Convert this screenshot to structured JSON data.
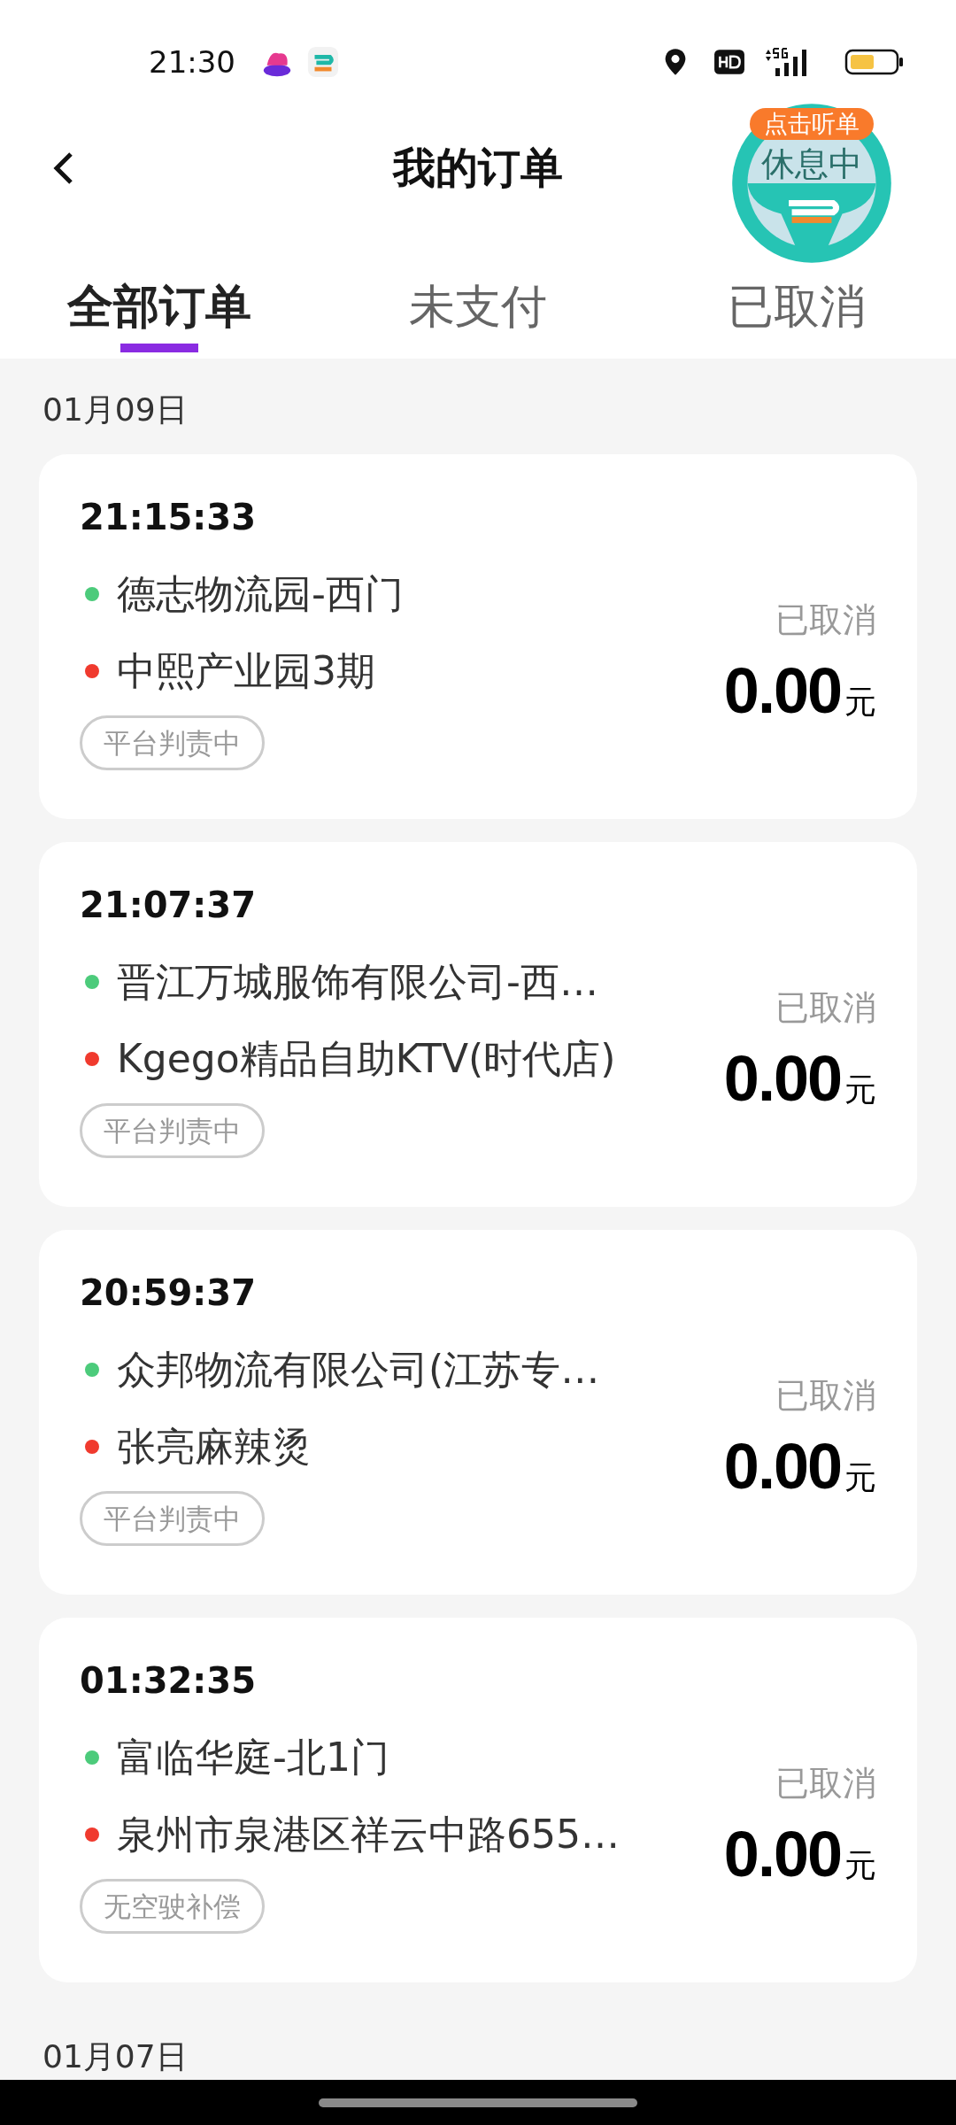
{
  "status_bar": {
    "time": "21:30"
  },
  "header": {
    "title": "我的订单"
  },
  "floating_badge": {
    "tag": "点击听单",
    "status": "休息中"
  },
  "tabs": [
    {
      "label": "全部订单",
      "selected": true
    },
    {
      "label": "未支付",
      "selected": false
    },
    {
      "label": "已取消",
      "selected": false
    }
  ],
  "groups": [
    {
      "date": "01月09日",
      "orders": [
        {
          "time": "21:15:33",
          "stops": [
            {
              "name": "德志物流园-西门",
              "color": "#4ccb7b"
            },
            {
              "name": "中熙产业园3期",
              "color": "#f03a2e"
            }
          ],
          "tag": "平台判责中",
          "status": "已取消",
          "amount": "0.00",
          "unit": "元"
        },
        {
          "time": "21:07:37",
          "stops": [
            {
              "name": "晋江万城服饰有限公司-西…",
              "color": "#4ccb7b"
            },
            {
              "name": "Kgego精品自助KTV(时代店)",
              "color": "#f03a2e"
            }
          ],
          "tag": "平台判责中",
          "status": "已取消",
          "amount": "0.00",
          "unit": "元"
        },
        {
          "time": "20:59:37",
          "stops": [
            {
              "name": "众邦物流有限公司(江苏专…",
              "color": "#4ccb7b"
            },
            {
              "name": "张亮麻辣烫",
              "color": "#f03a2e"
            }
          ],
          "tag": "平台判责中",
          "status": "已取消",
          "amount": "0.00",
          "unit": "元"
        },
        {
          "time": "01:32:35",
          "stops": [
            {
              "name": "富临华庭-北1门",
              "color": "#4ccb7b"
            },
            {
              "name": "泉州市泉港区祥云中路655…",
              "color": "#f03a2e"
            }
          ],
          "tag": "无空驶补偿",
          "status": "已取消",
          "amount": "0.00",
          "unit": "元"
        }
      ]
    },
    {
      "date": "01月07日"
    }
  ]
}
